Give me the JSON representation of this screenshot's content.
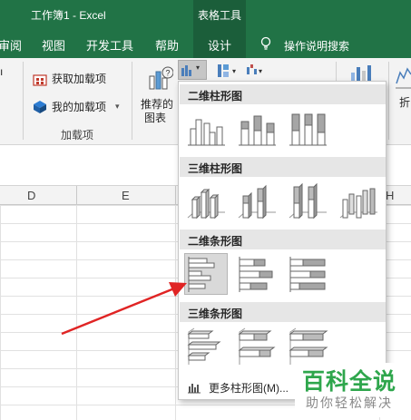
{
  "window": {
    "title": "工作簿1  -  Excel",
    "context_group": "表格工具"
  },
  "tabs": [
    "审阅",
    "视图",
    "开发工具",
    "帮助",
    "设计",
    "操作说明搜索"
  ],
  "ribbon": {
    "get_addins": "获取加载项",
    "my_addins": "我的加载项",
    "group_addins": "加载项",
    "recommended_line1": "推荐的",
    "recommended_line2": "图表",
    "line_partial": "折"
  },
  "sheet": {
    "columns": [
      "D",
      "E",
      "H"
    ]
  },
  "dropdown": {
    "sections": [
      "二维柱形图",
      "三维柱形图",
      "二维条形图",
      "三维条形图"
    ],
    "more_label": "更多柱形图(M)..."
  },
  "watermark": {
    "top": "百科全说",
    "bottom": "助你轻松解决"
  },
  "colors": {
    "excel_green": "#217346",
    "arrow_red": "#e02424",
    "watermark_green": "#2ea64c"
  }
}
